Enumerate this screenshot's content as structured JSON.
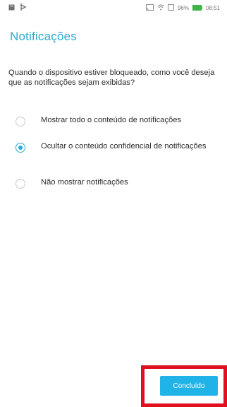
{
  "status_bar": {
    "battery_percent": "96%",
    "time": "08:51",
    "icons": [
      "notification-icon",
      "media-icon",
      "cast-icon",
      "wifi-icon",
      "phone-icon",
      "battery-icon"
    ]
  },
  "header": {
    "title": "Notificações"
  },
  "main": {
    "question": "Quando o dispositivo estiver bloqueado, como você deseja que as notificações sejam exibidas?",
    "options": [
      {
        "label": "Mostrar todo o conteúdo de notificações",
        "selected": false
      },
      {
        "label": "Ocultar o conteúdo confidencial de notificações",
        "selected": true
      },
      {
        "label": "Não mostrar notificações",
        "selected": false
      }
    ]
  },
  "footer": {
    "done_label": "Concluído"
  },
  "colors": {
    "accent": "#2aa9d6",
    "button": "#1fb3e8",
    "highlight": "#e11020"
  }
}
